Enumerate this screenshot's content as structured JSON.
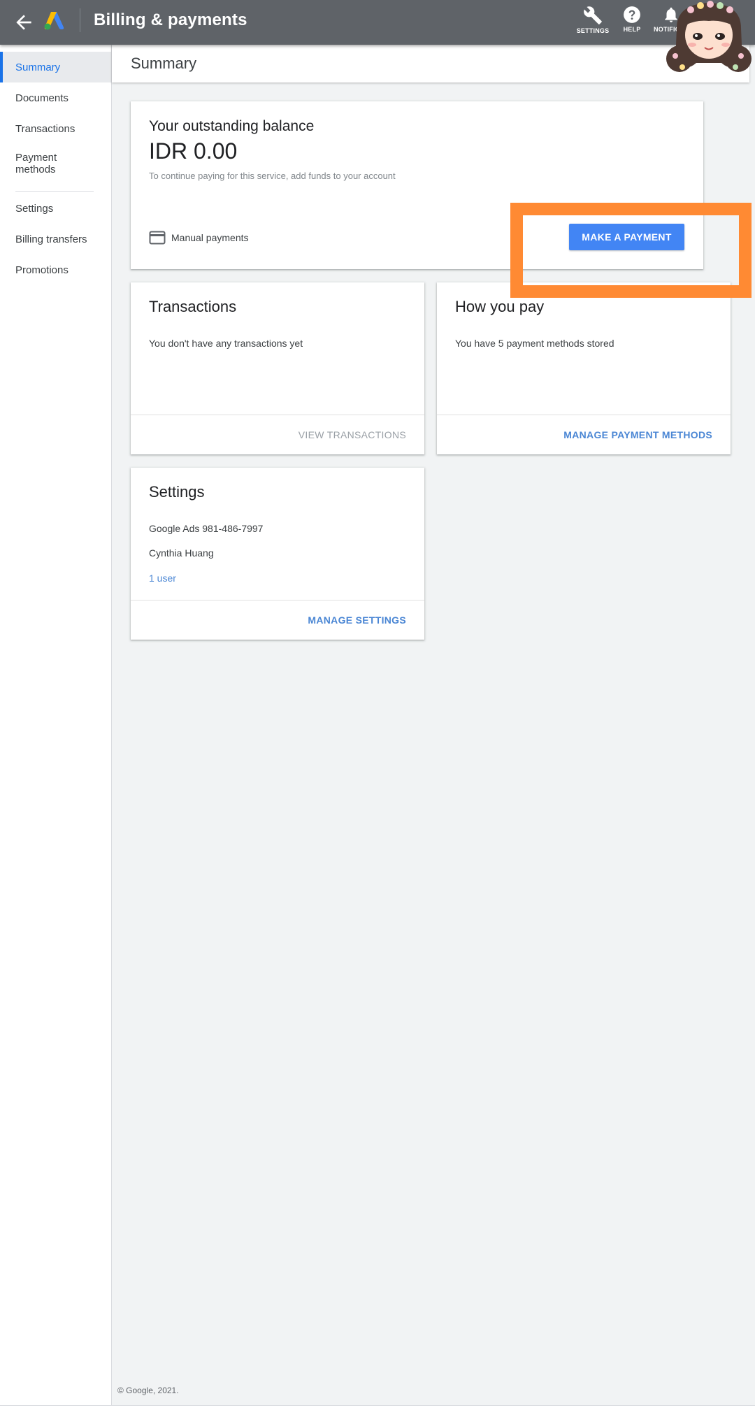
{
  "topbar": {
    "title": "Billing & payments",
    "tools": {
      "settings": "SETTINGS",
      "help": "HELP",
      "notifications": "NOTIFICA"
    }
  },
  "sidebar": {
    "items": [
      {
        "label": "Summary",
        "active": true
      },
      {
        "label": "Documents"
      },
      {
        "label": "Transactions"
      },
      {
        "label": "Payment methods"
      },
      {
        "label": "Settings"
      },
      {
        "label": "Billing transfers"
      },
      {
        "label": "Promotions"
      }
    ]
  },
  "page": {
    "title": "Summary"
  },
  "balance": {
    "heading": "Your outstanding balance",
    "amount": "IDR 0.00",
    "note": "To continue paying for this service, add funds to your account",
    "method": "Manual payments",
    "pay_label": "MAKE A PAYMENT"
  },
  "transactions": {
    "title": "Transactions",
    "text": "You don't have any transactions yet",
    "action": "VIEW TRANSACTIONS"
  },
  "how_you_pay": {
    "title": "How you pay",
    "text": "You have 5 payment methods stored",
    "action": "MANAGE PAYMENT METHODS"
  },
  "settings_card": {
    "title": "Settings",
    "account": "Google Ads 981-486-7997",
    "name": "Cynthia Huang",
    "users_link": "1 user",
    "action": "MANAGE SETTINGS"
  },
  "footer": {
    "copyright": "© Google, 2021."
  },
  "colors": {
    "topbar": "#5f6368",
    "accent": "#1a73e8",
    "button": "#4285f4",
    "highlight": "#ff8a33",
    "background": "#f1f3f4"
  }
}
